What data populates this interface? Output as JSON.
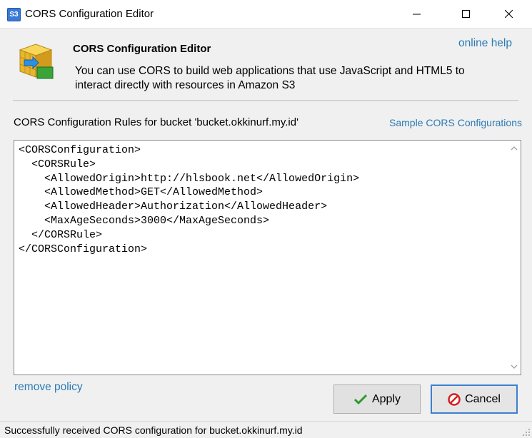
{
  "window": {
    "app_icon_text": "S3",
    "title": "CORS Configuration Editor"
  },
  "header": {
    "title": "CORS Configuration Editor",
    "description": "You can use CORS to build web applications that use JavaScript and HTML5 to interact directly with resources in Amazon S3",
    "online_help": "online help"
  },
  "rules": {
    "label": "CORS Configuration Rules for bucket 'bucket.okkinurf.my.id'",
    "sample_link": "Sample CORS Configurations"
  },
  "editor": {
    "lines": [
      "<CORSConfiguration>",
      "  <CORSRule>",
      "    <AllowedOrigin>http://hlsbook.net</AllowedOrigin>",
      "    <AllowedMethod>GET</AllowedMethod>",
      "    <AllowedHeader>Authorization</AllowedHeader>",
      "    <MaxAgeSeconds>3000</MaxAgeSeconds>",
      "  </CORSRule>",
      "</CORSConfiguration>"
    ]
  },
  "footer": {
    "remove_policy": "remove policy",
    "apply_label": "Apply",
    "cancel_label": "Cancel"
  },
  "status": {
    "text": "Successfully received CORS configuration for bucket.okkinurf.my.id"
  },
  "colors": {
    "link": "#2a7ab5",
    "focus_border": "#3c7fd1"
  }
}
